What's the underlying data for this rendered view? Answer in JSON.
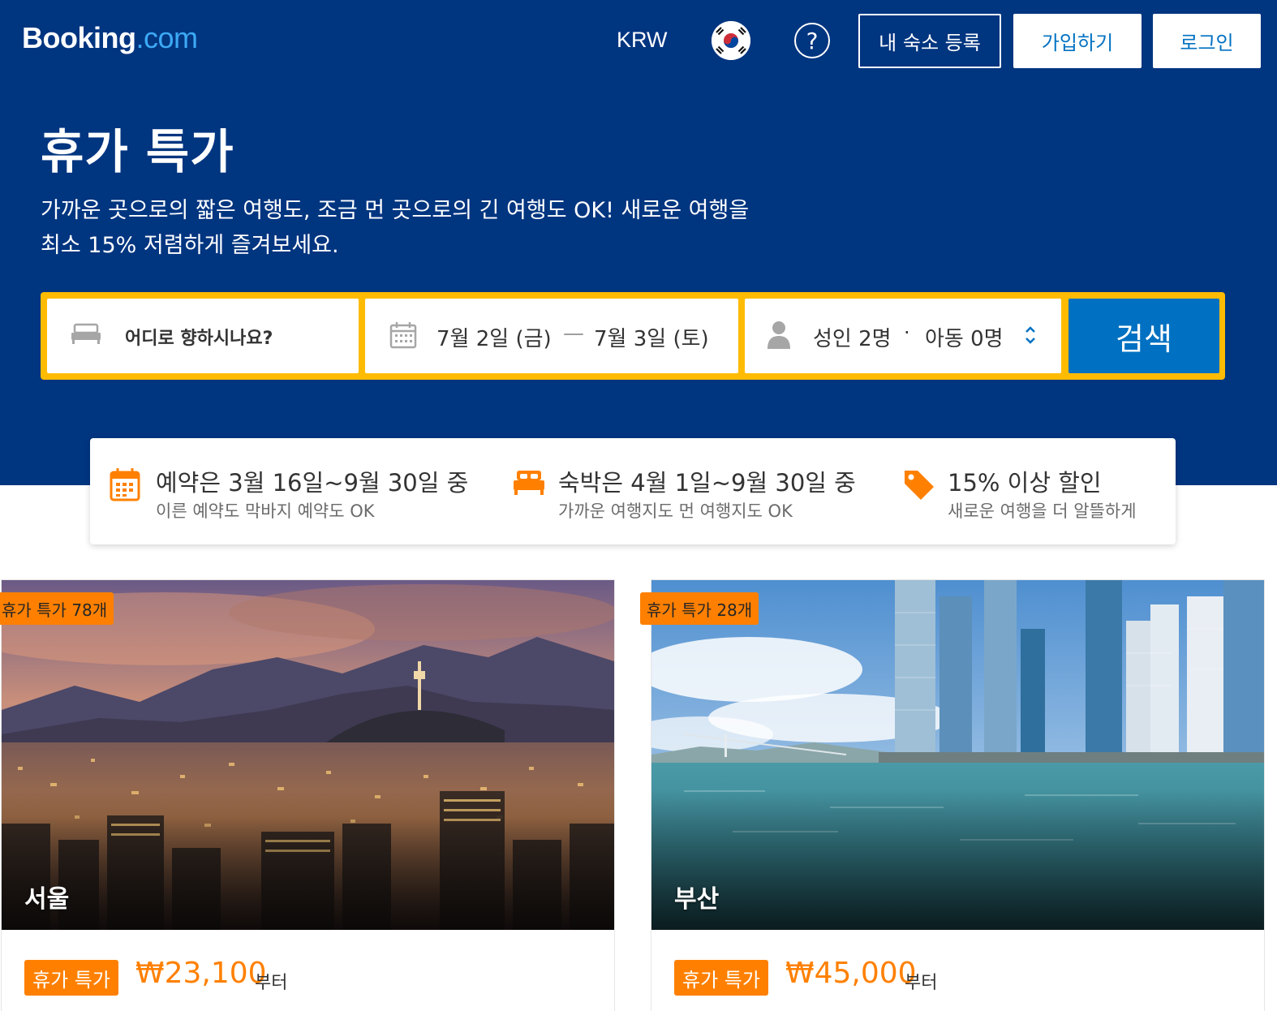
{
  "colors": {
    "brand_dark": "#003580",
    "brand_blue": "#0071c2",
    "accent_yellow": "#febb02",
    "deal_orange": "#ff8000",
    "logo_tld": "#3da9f5"
  },
  "header": {
    "logo_main": "Booking",
    "logo_tld": ".com",
    "currency": "KRW",
    "language_flag_icon": "south-korea-flag-icon",
    "help_icon": "question-circle-icon",
    "list_property_label": "내 숙소 등록",
    "signup_label": "가입하기",
    "login_label": "로그인"
  },
  "hero": {
    "title": "휴가 특가",
    "subtitle_line1": "가까운 곳으로의 짧은 여행도, 조금 먼 곳으로의 긴 여행도 OK! 새로운 여행을",
    "subtitle_line2": "최소 15% 저렴하게 즐겨보세요."
  },
  "search": {
    "destination_placeholder": "어디로 향하시나요?",
    "checkin": "7월 2일 (금)",
    "date_separator": "—",
    "checkout": "7월 3일 (토)",
    "adults": "성인 2명",
    "guest_separator": "·",
    "children": "아동 0명",
    "button_label": "검색",
    "icons": [
      "bed-icon",
      "calendar-icon",
      "person-icon",
      "chevron-updown-icon"
    ]
  },
  "benefits": [
    {
      "icon": "calendar-icon",
      "title": "예약은 3월 16일~9월 30일 중",
      "subtitle": "이른 예약도 막바지 예약도 OK"
    },
    {
      "icon": "bed-icon",
      "title": "숙박은 4월 1일~9월 30일 중",
      "subtitle": "가까운 여행지도 먼 여행지도 OK"
    },
    {
      "icon": "price-tag-icon",
      "title": "15% 이상 할인",
      "subtitle": "새로운 여행을 더 알뜰하게"
    }
  ],
  "destinations": [
    {
      "city": "서울",
      "deal_count_label": "휴가 특가 78개",
      "deal_badge": "휴가 특가",
      "price": "₩23,100",
      "price_suffix": "부터"
    },
    {
      "city": "부산",
      "deal_count_label": "휴가 특가 28개",
      "deal_badge": "휴가 특가",
      "price": "₩45,000",
      "price_suffix": "부터"
    }
  ]
}
